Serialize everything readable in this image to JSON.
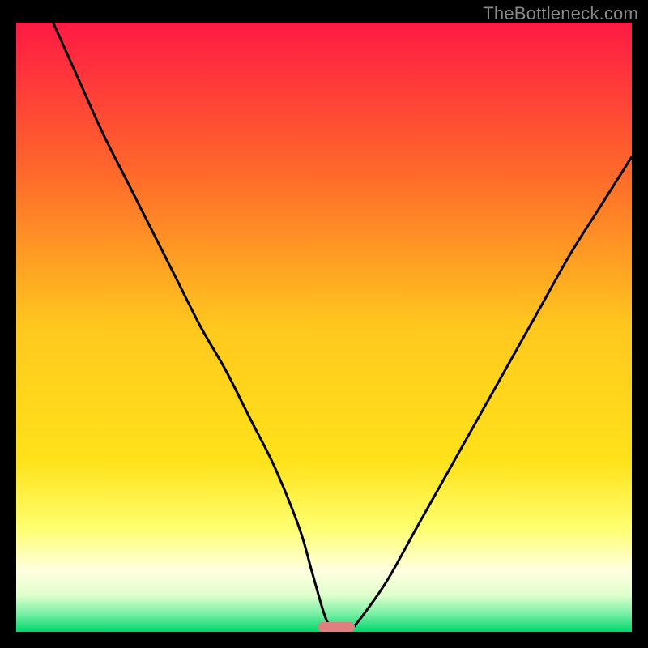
{
  "watermark": "TheBottleneck.com",
  "chart_data": {
    "type": "line",
    "title": "",
    "xlabel": "",
    "ylabel": "",
    "xlim": [
      0,
      100
    ],
    "ylim": [
      0,
      100
    ],
    "legend": false,
    "grid": false,
    "background_gradient": {
      "stops": [
        {
          "offset": 0.0,
          "color": "#ff1a44"
        },
        {
          "offset": 0.25,
          "color": "#ff6a2a"
        },
        {
          "offset": 0.5,
          "color": "#ffc81e"
        },
        {
          "offset": 0.72,
          "color": "#ffe21a"
        },
        {
          "offset": 0.83,
          "color": "#ffff70"
        },
        {
          "offset": 0.9,
          "color": "#ffffe0"
        },
        {
          "offset": 0.94,
          "color": "#e0ffcc"
        },
        {
          "offset": 0.97,
          "color": "#7af0a6"
        },
        {
          "offset": 1.0,
          "color": "#00d76a"
        }
      ]
    },
    "series": [
      {
        "name": "bottleneck-curve",
        "color": "#000000",
        "x": [
          6,
          10,
          14,
          18,
          22,
          26,
          30,
          34,
          38,
          42,
          46,
          48,
          50,
          51,
          52,
          54,
          55,
          60,
          65,
          70,
          75,
          80,
          85,
          90,
          95,
          100
        ],
        "values": [
          100,
          91,
          82,
          74,
          66,
          58,
          50,
          43,
          35,
          27,
          17,
          10,
          3,
          1,
          0.5,
          0.5,
          1,
          8,
          17,
          26,
          35,
          44,
          53,
          62,
          70,
          78
        ]
      }
    ],
    "marker": {
      "name": "optimal-point",
      "shape": "rounded-bar",
      "x_center": 52,
      "x_width": 6,
      "y": 0,
      "color": "#e07f7f"
    }
  }
}
